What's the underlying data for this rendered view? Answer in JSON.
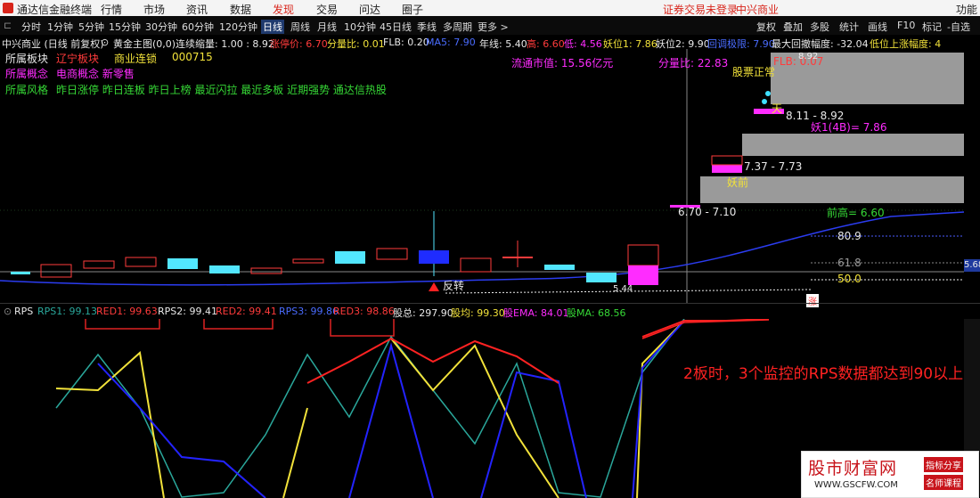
{
  "titlebar": {
    "app_name": "通达信金融终端",
    "menu": [
      "行情",
      "市场",
      "资讯",
      "数据",
      "发现",
      "交易",
      "问达",
      "圈子"
    ],
    "login_status": "证券交易未登录",
    "stock_name": "中兴商业",
    "function_label": "功能"
  },
  "toolbar": {
    "left_items": [
      "分时",
      "1分钟",
      "5分钟",
      "15分钟",
      "30分钟",
      "60分钟",
      "120分钟",
      "日线",
      "周线",
      "月线",
      "10分钟",
      "45日线",
      "季线",
      "多周期",
      "更多 >"
    ],
    "right_items": [
      "复权",
      "叠加",
      "多股",
      "统计",
      "画线",
      "F10",
      "标记",
      "-自选"
    ]
  },
  "inforow": {
    "stock": "中兴商业 (日线 前复权)",
    "indicator": "黄金主图(0,0)",
    "lianxu": "连续缩量: 1.00 : 8.92",
    "zhangting": "涨停价: 6.70",
    "fenliangbi": "分量比: 0.01",
    "flb": "FLB: 0.20",
    "extra": "MA5: 7.90",
    "nianxian": "年线: 5.40",
    "gao": "高: 6.60",
    "di": "低: 4.56",
    "yaowei": "妖位1: 7.86",
    "yaowei2": "妖位2: 9.90",
    "weishi": "回调极限: 7.90",
    "max_pullback": "最大回撤幅度: -32.04",
    "low_up": "低位上涨幅度: 4"
  },
  "main_chart": {
    "bankuai_label": "所属板块",
    "bankuai_1": "辽宁板块",
    "bankuai_2": "商业连锁",
    "code": "000715",
    "gainian_label": "所属概念",
    "gainian_items": "电商概念 新零售",
    "fengge_label": "所属风格",
    "fengge_items": "昨日涨停 昨日连板 昨日上榜 最近闪拉 最近多板 近期强势 通达信热股",
    "circ_value": "流通市值: 15.56亿元",
    "fenliangbi2": "分量比: 22.83",
    "flb2": "FLB: 0.07",
    "gupiao_status": "股票正常",
    "tian_label": "天",
    "range_1": "8.11 - 8.92",
    "yao1_label": "妖1(4B)= 7.86",
    "range_2": "7.37 - 7.73",
    "yaoqian": "妖前",
    "range_3": "6.70 - 7.10",
    "qiangao": "前高= 6.60",
    "axis_80_9": "80.9",
    "axis_61_8": "61.8",
    "axis_50_0": "50.0",
    "fanzhuan": "反转",
    "low_544": "5.44",
    "price_right": "5.68",
    "value_892": "8.92",
    "zhang_icon": "涨"
  },
  "rps_bar": {
    "name": "RPS",
    "rps1": "RPS1: 99.13",
    "red1": "RED1: 99.63",
    "rps2": "RPS2: 99.41",
    "red2": "RED2: 99.41",
    "rps3": "RPS3: 99.86",
    "red3": "RED3: 98.86",
    "zongfen": "股总: 297.90",
    "guli": "股均: 99.30",
    "ema": "股EMA: 84.01",
    "ma": "股MA: 68.56"
  },
  "annotation": "2板时，3个监控的RPS数据都达到90以上",
  "watermark": {
    "title": "股市财富网",
    "tag1": "指标分享",
    "tag2": "名师课程",
    "url": "WWW.GSCFW.COM"
  },
  "colors": {
    "up": "#ff3b3b",
    "down": "#3fd0d0",
    "accent_magenta": "#ff2cff",
    "rps_red": "#ff2222",
    "rps_yellow": "#f2e23a",
    "rps_blue": "#2323ff",
    "rps_teal": "#2aa79b"
  }
}
